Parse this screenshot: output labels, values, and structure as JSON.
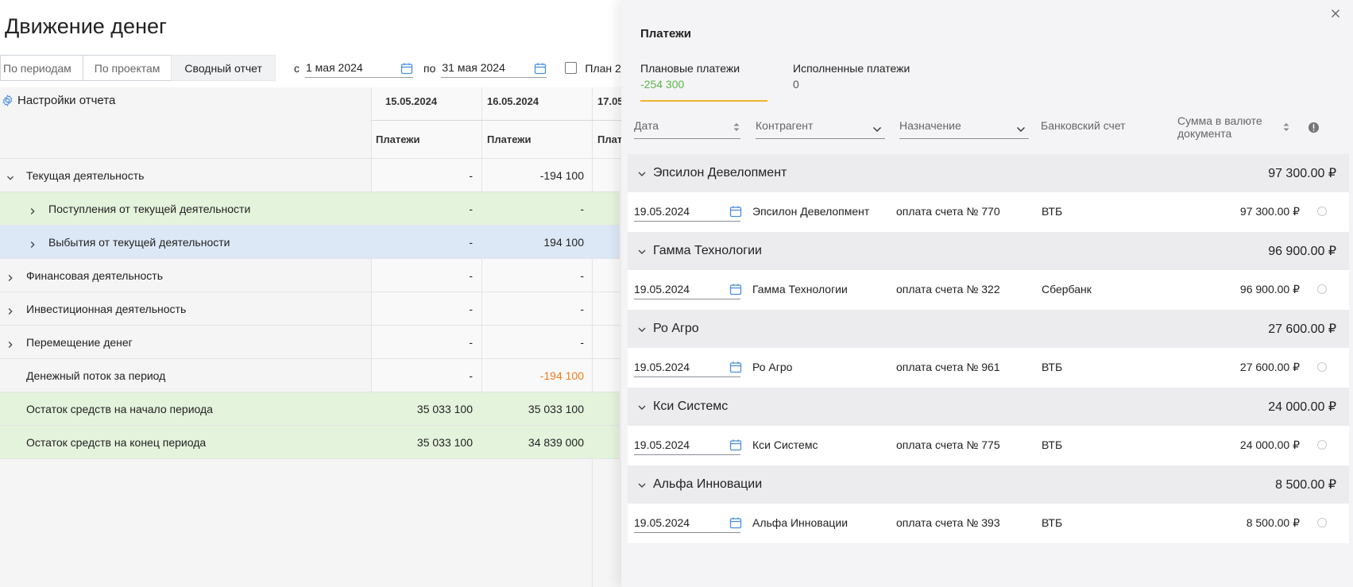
{
  "page_title": "Движение денег",
  "tabs": [
    {
      "label": "По периодам"
    },
    {
      "label": "По проектам"
    },
    {
      "label": "Сводный отчет"
    }
  ],
  "filters": {
    "from_label": "с",
    "from_date": "1 мая 2024",
    "to_label": "по",
    "to_date": "31 мая 2024",
    "plan_label": "План 2"
  },
  "settings_label": "Настройки отчета",
  "columns": {
    "dates": [
      "15.05.2024",
      "16.05.2024",
      "17.05"
    ],
    "sub": [
      "Платежи",
      "Платежи",
      "Плат"
    ]
  },
  "rows": [
    {
      "label": "Текущая деятельность",
      "v1": "-",
      "v2": "-194 100"
    },
    {
      "label": "Поступления от текущей деятельности",
      "v1": "-",
      "v2": "-"
    },
    {
      "label": "Выбытия от текущей деятельности",
      "v1": "-",
      "v2": "194 100"
    },
    {
      "label": "Финансовая деятельность",
      "v1": "-",
      "v2": "-"
    },
    {
      "label": "Инвестиционная деятельность",
      "v1": "-",
      "v2": "-"
    },
    {
      "label": "Перемещение денег",
      "v1": "-",
      "v2": "-"
    },
    {
      "label": "Денежный поток за период",
      "v1": "-",
      "v2": "-194 100"
    },
    {
      "label": "Остаток средств на начало периода",
      "v1": "35 033 100",
      "v2": "35 033 100"
    },
    {
      "label": "Остаток средств на конец периода",
      "v1": "35 033 100",
      "v2": "34 839 000"
    }
  ],
  "colors": {
    "accent_orange": "#f07a1a",
    "green_row": "#e4f3dc",
    "blue_row": "#dde8f7",
    "planned_green": "#5bb84a",
    "tab_underline": "#f0b429"
  },
  "drawer": {
    "title": "Платежи",
    "tabs": [
      {
        "label": "Плановые платежи",
        "amount": "-254 300"
      },
      {
        "label": "Исполненные платежи",
        "amount": "0"
      }
    ],
    "headers": {
      "date": "Дата",
      "counterparty": "Контрагент",
      "purpose": "Назначение",
      "account": "Банковский счет",
      "sum": "Сумма в валюте документа"
    },
    "groups": [
      {
        "name": "Эпсилон Девелопмент",
        "sum": "97 300.00 ₽",
        "item": {
          "date": "19.05.2024",
          "counterparty": "Эпсилон Девелопмент",
          "purpose": "оплата счета № 770",
          "account": "ВТБ",
          "sum": "97 300.00 ₽"
        }
      },
      {
        "name": "Гамма Технологии",
        "sum": "96 900.00 ₽",
        "item": {
          "date": "19.05.2024",
          "counterparty": "Гамма Технологии",
          "purpose": "оплата счета № 322",
          "account": "Сбербанк",
          "sum": "96 900.00 ₽"
        }
      },
      {
        "name": "Ро Агро",
        "sum": "27 600.00 ₽",
        "item": {
          "date": "19.05.2024",
          "counterparty": "Ро Агро",
          "purpose": "оплата счета № 961",
          "account": "ВТБ",
          "sum": "27 600.00 ₽"
        }
      },
      {
        "name": "Кси Системс",
        "sum": "24 000.00 ₽",
        "item": {
          "date": "19.05.2024",
          "counterparty": "Кси Системс",
          "purpose": "оплата счета № 775",
          "account": "ВТБ",
          "sum": "24 000.00 ₽"
        }
      },
      {
        "name": "Альфа Инновации",
        "sum": "8 500.00 ₽",
        "item": {
          "date": "19.05.2024",
          "counterparty": "Альфа Инновации",
          "purpose": "оплата счета № 393",
          "account": "ВТБ",
          "sum": "8 500.00 ₽"
        }
      }
    ]
  }
}
